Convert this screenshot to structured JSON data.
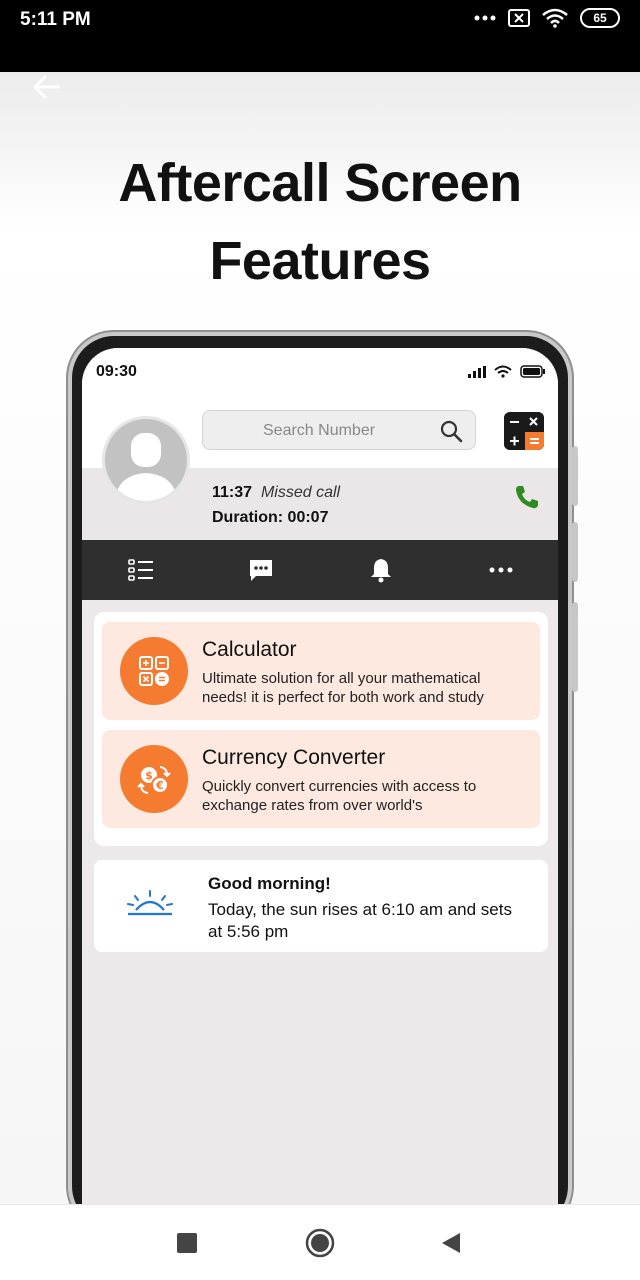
{
  "status_bar": {
    "time": "5:11 PM",
    "battery": "65",
    "icons": [
      "more-dots-icon",
      "sim-x-icon",
      "wifi-icon",
      "battery-icon"
    ]
  },
  "banner": {
    "back_icon": "back-arrow-icon",
    "headline_line1": "Aftercall Screen",
    "headline_line2": "Features"
  },
  "phone_mockup": {
    "status_time": "09:30",
    "search_placeholder": "Search Number",
    "call": {
      "time": "11:37",
      "type": "Missed call",
      "duration_label": "Duration: 00:07"
    },
    "tabs": [
      "list-icon",
      "message-icon",
      "bell-icon",
      "more-icon"
    ],
    "features": [
      {
        "title": "Calculator",
        "description": "Ultimate solution for all your mathematical needs! it is perfect for both work and study",
        "icon": "calculator-icon"
      },
      {
        "title": "Currency Converter",
        "description": "Quickly convert currencies with access to exchange rates from over world's",
        "icon": "currency-exchange-icon"
      }
    ],
    "greeting": {
      "title": "Good morning!",
      "text": "Today, the sun rises at 6:10 am and sets at 5:56 pm"
    }
  },
  "colors": {
    "accent_orange": "#f47b30",
    "feature_bg": "#fde9df",
    "tab_bar": "#2f2f2f",
    "call_green": "#2e8b22",
    "sun_blue": "#1e78d2"
  },
  "nav_bar": [
    "recents-square-icon",
    "home-circle-icon",
    "back-triangle-icon"
  ]
}
